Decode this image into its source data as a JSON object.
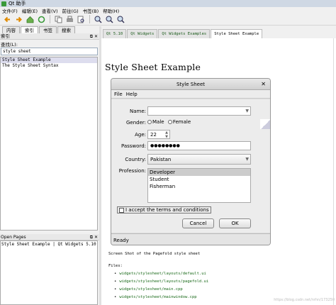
{
  "window": {
    "title": "Qt 助手"
  },
  "menu": [
    "文件(F)",
    "编辑(E)",
    "查看(V)",
    "前往(G)",
    "书签(B)",
    "帮助(H)"
  ],
  "toolbar_icons": [
    "back-arrow-icon",
    "forward-arrow-icon",
    "home-icon",
    "sync-icon",
    "copy-icon",
    "print-icon",
    "find-icon",
    "zoom-in-icon",
    "zoom-out-icon",
    "zoom-reset-icon"
  ],
  "sidebar": {
    "tabs": [
      {
        "label": "内容"
      },
      {
        "label": "索引"
      },
      {
        "label": "书签"
      },
      {
        "label": "搜索"
      }
    ],
    "active_tab": 1,
    "index_header": "索引",
    "look_for_label": "查找(L):",
    "look_for_value": "style sheet",
    "results": [
      "Style Sheet Example",
      "The Style Sheet Syntax"
    ],
    "open_pages_header": "Open Pages",
    "open_pages_value": "Style Sheet Example | Qt Widgets 5.10"
  },
  "doc_tabs": [
    {
      "label": "Qt 5.10"
    },
    {
      "label": "Qt Widgets"
    },
    {
      "label": "Qt Widgets Examples"
    },
    {
      "label": "Style Sheet Example"
    }
  ],
  "content": {
    "heading": "Style Sheet Example",
    "screenshot": {
      "title": "Style Sheet",
      "menu": [
        "File",
        "Help"
      ],
      "name_label": "Name:",
      "name_value": "",
      "gender_label": "Gender:",
      "male_label": "Male",
      "female_label": "Female",
      "age_label": "Age:",
      "age_value": "22",
      "password_label": "Password:",
      "password_value": "●●●●●●●●",
      "country_label": "Country:",
      "country_value": "Pakistan",
      "profession_label": "Profession:",
      "professions": [
        "Developer",
        "Student",
        "Fisherman"
      ],
      "terms_label": "I accept the terms and conditions",
      "cancel_label": "Cancel",
      "ok_label": "OK",
      "status": "Ready"
    },
    "caption": "Screen Shot of the Pagefold style sheet",
    "files_label": "Files:",
    "files": [
      "widgets/stylesheet/layouts/default.ui",
      "widgets/stylesheet/layouts/pagefold.ui",
      "widgets/stylesheet/main.cpp",
      "widgets/stylesheet/mainwindow.cpp"
    ],
    "watermark": "https://blog.csdn.net/nrhn/173250"
  }
}
